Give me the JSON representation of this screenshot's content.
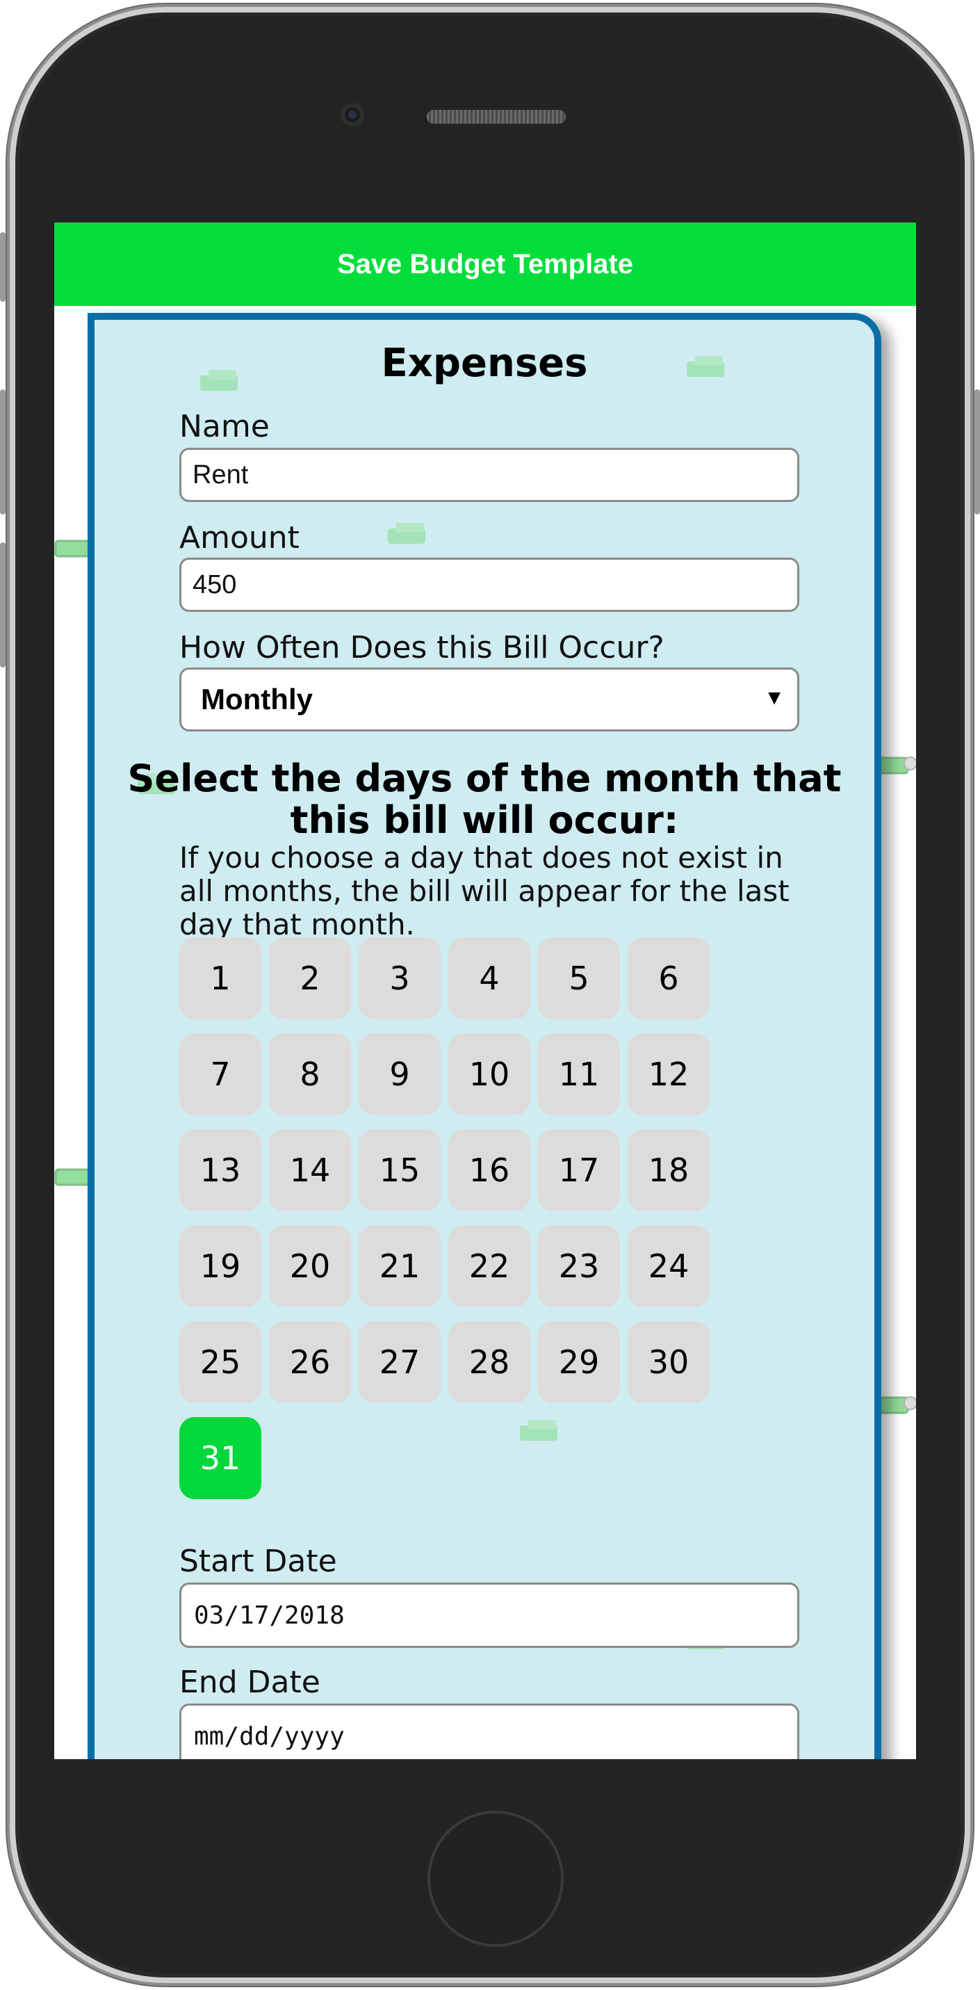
{
  "header": {
    "save_label": "Save Budget Template"
  },
  "panel": {
    "title": "Expenses"
  },
  "form": {
    "name_label": "Name",
    "name_value": "Rent",
    "amount_label": "Amount",
    "amount_value": "450",
    "frequency_label": "How Often Does this Bill Occur?",
    "frequency_value": "Monthly",
    "days_title": "Select the days of the month that this bill will occur:",
    "days_note": "If you choose a day that does not exist in all months, the bill will appear for the last day that month.",
    "days": [
      "1",
      "2",
      "3",
      "4",
      "5",
      "6",
      "7",
      "8",
      "9",
      "10",
      "11",
      "12",
      "13",
      "14",
      "15",
      "16",
      "17",
      "18",
      "19",
      "20",
      "21",
      "22",
      "23",
      "24",
      "25",
      "26",
      "27",
      "28",
      "29",
      "30",
      "31"
    ],
    "selected_days": [
      "31"
    ],
    "start_label": "Start Date",
    "start_value": "03/17/2018",
    "end_label": "End Date",
    "end_placeholder": "mm/dd/yyyy"
  },
  "colors": {
    "accent": "#02dd3c",
    "panel_border": "#0a6ea6",
    "panel_bg": "#cfecf1",
    "day_bg": "#dddcda"
  },
  "icons": {
    "background_pattern": "money-stack-icon",
    "dropdown": "caret-down-icon"
  }
}
